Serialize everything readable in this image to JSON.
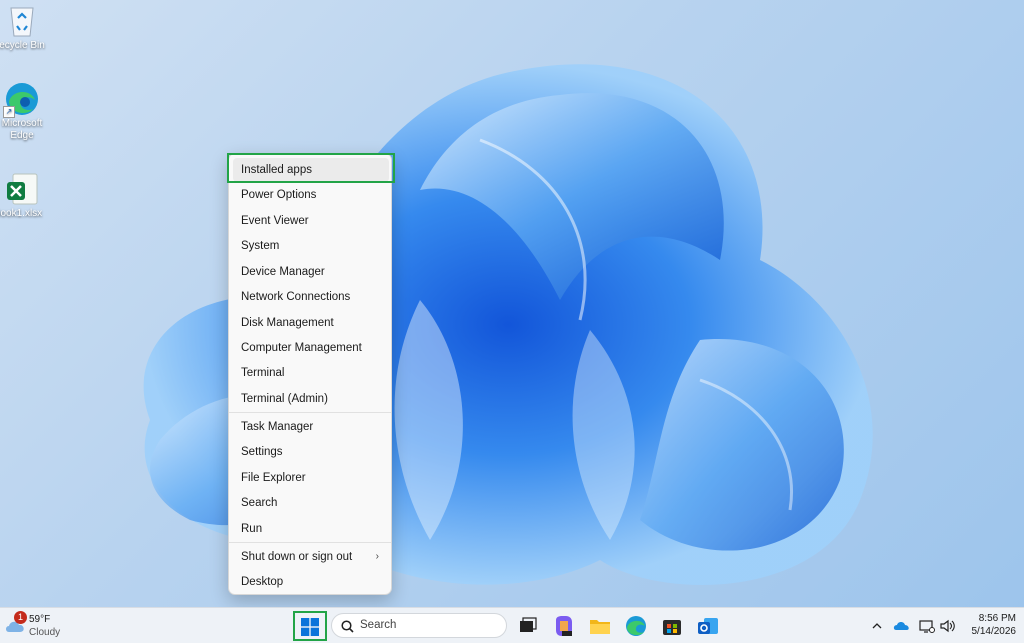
{
  "desktop": {
    "icons": [
      {
        "label": "Recycle Bin"
      },
      {
        "label": "Microsoft Edge"
      },
      {
        "label": "Book1.xlsx"
      }
    ]
  },
  "context_menu": {
    "items": [
      {
        "label": "Installed apps"
      },
      {
        "label": "Power Options"
      },
      {
        "label": "Event Viewer"
      },
      {
        "label": "System"
      },
      {
        "label": "Device Manager"
      },
      {
        "label": "Network Connections"
      },
      {
        "label": "Disk Management"
      },
      {
        "label": "Computer Management"
      },
      {
        "label": "Terminal"
      },
      {
        "label": "Terminal (Admin)"
      },
      {
        "label": "Task Manager"
      },
      {
        "label": "Settings"
      },
      {
        "label": "File Explorer"
      },
      {
        "label": "Search"
      },
      {
        "label": "Run"
      },
      {
        "label": "Shut down or sign out"
      },
      {
        "label": "Desktop"
      }
    ],
    "highlighted": "Installed apps"
  },
  "taskbar": {
    "weather": {
      "temp": "59°F",
      "condition": "Cloudy",
      "badge": "1"
    },
    "search_placeholder": "Search",
    "apps": [
      "task-view-icon",
      "copilot-icon",
      "file-explorer-icon",
      "edge-icon",
      "store-icon",
      "outlook-icon"
    ],
    "tray_icons": [
      "chevron-up-icon",
      "onedrive-icon",
      "network-icon",
      "volume-icon"
    ],
    "time": "8:56 PM",
    "date": "5/14/2026"
  },
  "colors": {
    "accent": "#0067c0",
    "highlight_border": "#22a447"
  }
}
